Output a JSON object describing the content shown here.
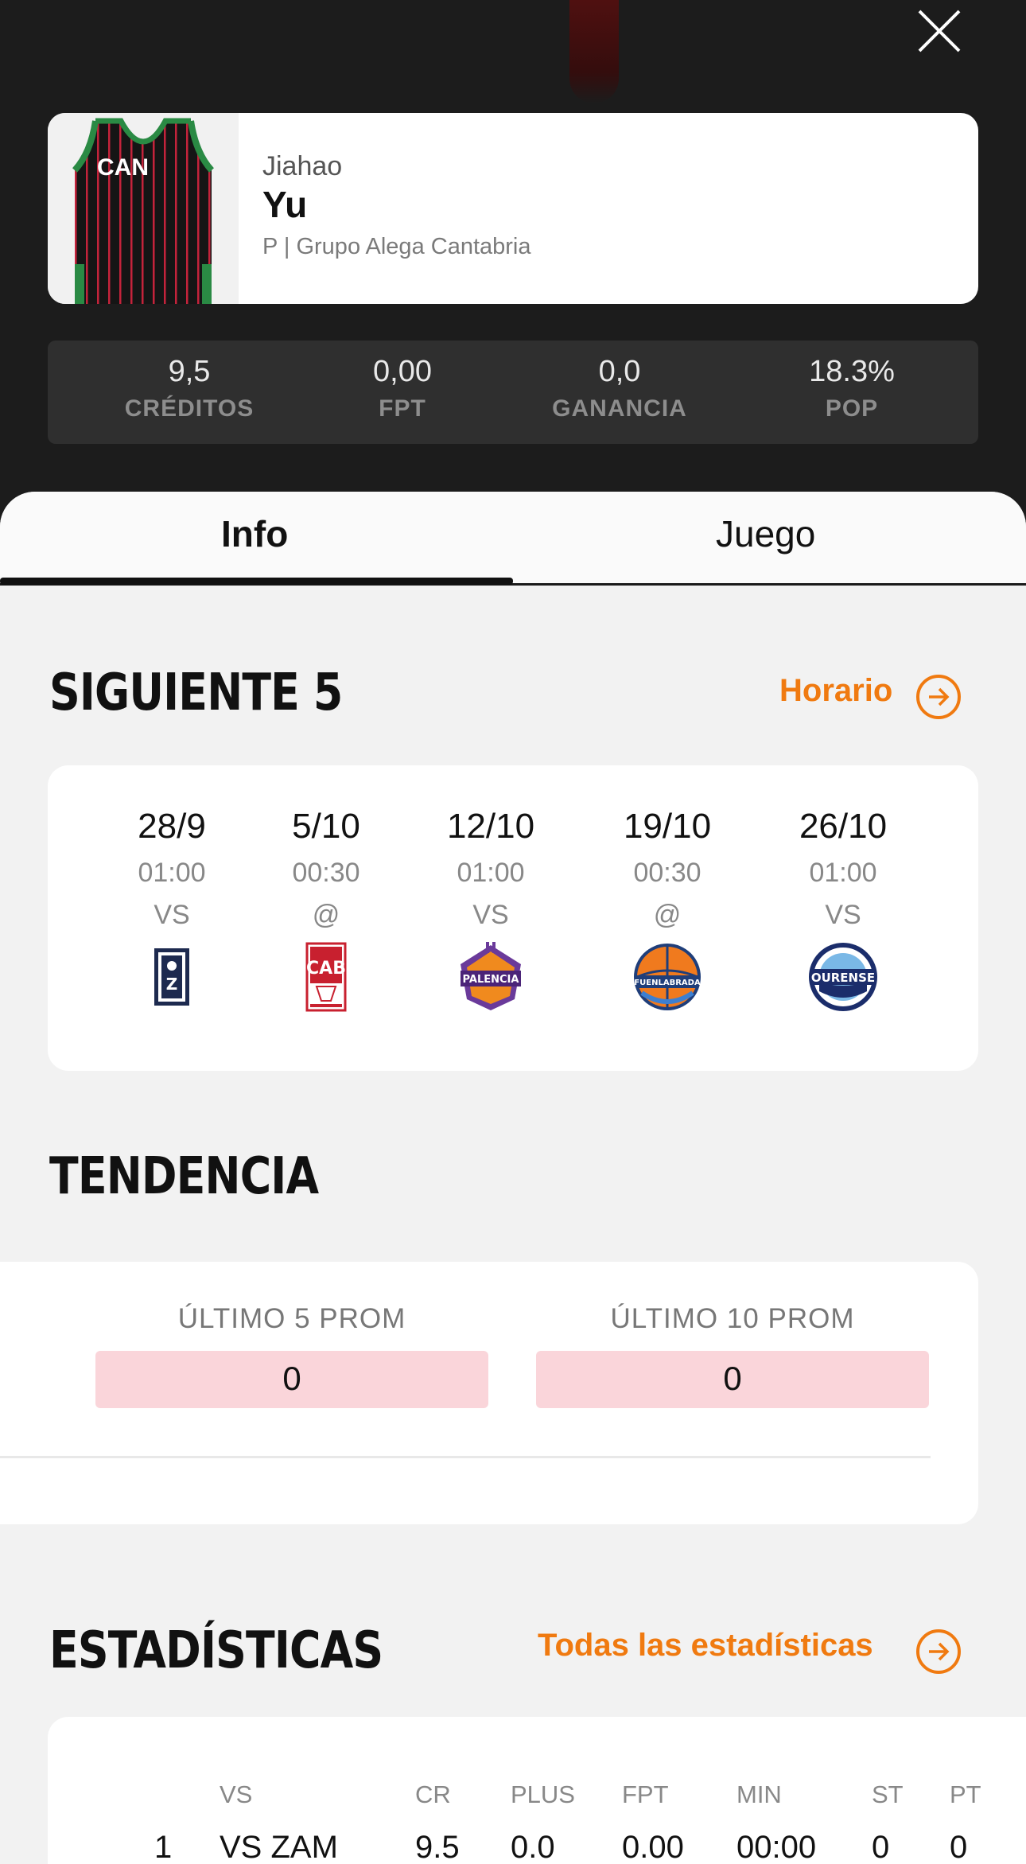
{
  "player": {
    "first_name": "Jiahao",
    "last_name": "Yu",
    "meta": "P | Grupo Alega Cantabria",
    "jersey_text": "CAN"
  },
  "stats": [
    {
      "value": "9,5",
      "label": "CRÉDITOS"
    },
    {
      "value": "0,00",
      "label": "FPT"
    },
    {
      "value": "0,0",
      "label": "GANANCIA"
    },
    {
      "value": "18.3%",
      "label": "POP"
    }
  ],
  "tabs": {
    "info": "Info",
    "juego": "Juego"
  },
  "next5": {
    "title": "SIGUIENTE 5",
    "link": "Horario",
    "games": [
      {
        "date": "28/9",
        "time": "01:00",
        "vs": "VS",
        "logo": "zamora-logo"
      },
      {
        "date": "5/10",
        "time": "00:30",
        "vs": "@",
        "logo": "obradoiro-logo"
      },
      {
        "date": "12/10",
        "time": "01:00",
        "vs": "VS",
        "logo": "palencia-logo"
      },
      {
        "date": "19/10",
        "time": "00:30",
        "vs": "@",
        "logo": "fuenlabrada-logo"
      },
      {
        "date": "26/10",
        "time": "01:00",
        "vs": "VS",
        "logo": "ourense-logo"
      }
    ]
  },
  "trend": {
    "title": "TENDENCIA",
    "last5_label": "ÚLTIMO 5 PROM",
    "last5_value": "0",
    "last10_label": "ÚLTIMO 10 PROM",
    "last10_value": "0"
  },
  "estadisticas": {
    "title": "ESTADÍSTICAS",
    "link": "Todas las estadísticas",
    "headers": [
      "VS",
      "CR",
      "PLUS",
      "FPT",
      "MIN",
      "ST",
      "PT"
    ],
    "row": [
      "1",
      "VS ZAM",
      "9.5",
      "0.0",
      "0.00",
      "00:00",
      "0",
      "0"
    ]
  },
  "colors": {
    "accent": "#f07a10",
    "dark_bg": "#1c1c1c",
    "trend_fill": "#fad5da"
  }
}
